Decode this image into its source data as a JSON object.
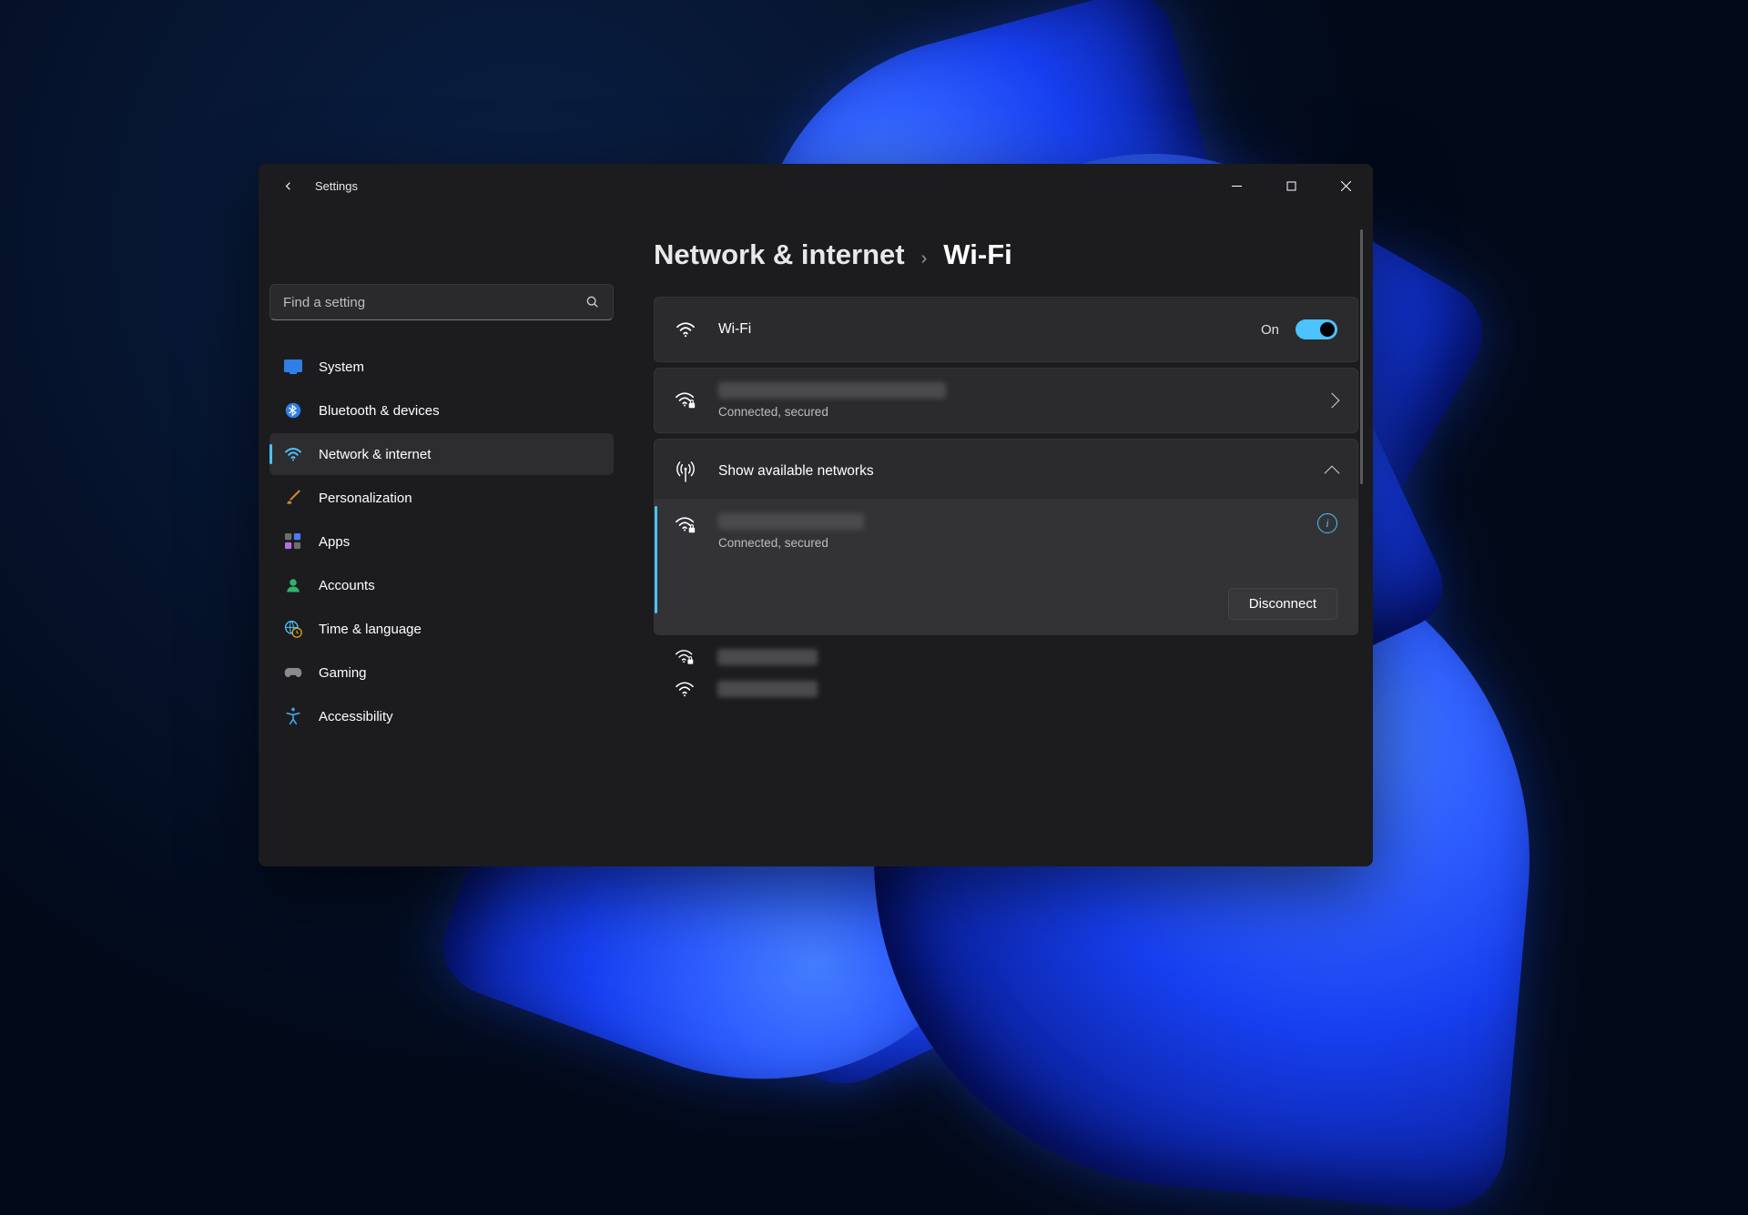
{
  "window": {
    "title": "Settings"
  },
  "search": {
    "placeholder": "Find a setting"
  },
  "sidebar": {
    "items": [
      {
        "label": "System"
      },
      {
        "label": "Bluetooth & devices"
      },
      {
        "label": "Network & internet"
      },
      {
        "label": "Personalization"
      },
      {
        "label": "Apps"
      },
      {
        "label": "Accounts"
      },
      {
        "label": "Time & language"
      },
      {
        "label": "Gaming"
      },
      {
        "label": "Accessibility"
      }
    ],
    "active_index": 2
  },
  "breadcrumb": {
    "parent": "Network & internet",
    "separator": "›",
    "current": "Wi-Fi"
  },
  "wifi_card": {
    "title": "Wi-Fi",
    "state_label": "On"
  },
  "connected_card": {
    "status": "Connected, secured"
  },
  "available_card": {
    "title": "Show available networks"
  },
  "active_network": {
    "status": "Connected, secured",
    "disconnect_label": "Disconnect"
  },
  "colors": {
    "accent": "#4cc2ff",
    "window_bg": "#1c1c1e",
    "card_bg": "#2b2b2d"
  }
}
